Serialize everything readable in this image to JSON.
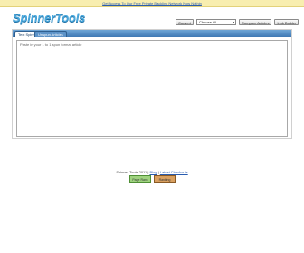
{
  "promo": {
    "text": "Get Access To Our Free Private Backlink Network Now Nothin"
  },
  "brand": {
    "logo": "SpinnerTools"
  },
  "controls": {
    "convert_label": "Convert",
    "select_value": "Choose All",
    "compare_label": "Compare Articles",
    "link_builder_label": "Link Builder"
  },
  "tabs": [
    {
      "label": "Text Spinner",
      "active": true
    },
    {
      "label": "Unspun Articles",
      "active": false
    }
  ],
  "editor": {
    "placeholder": "Paste in your 1 to 1 spun format article"
  },
  "footer": {
    "copyright": "Spinner Tools 2011",
    "link1": "Blog",
    "link2": "Latest Checkouts"
  },
  "badges": [
    {
      "label": "Page Rank",
      "color": "#9fd37f"
    },
    {
      "label": "Ranking",
      "color": "#d9a060"
    }
  ]
}
